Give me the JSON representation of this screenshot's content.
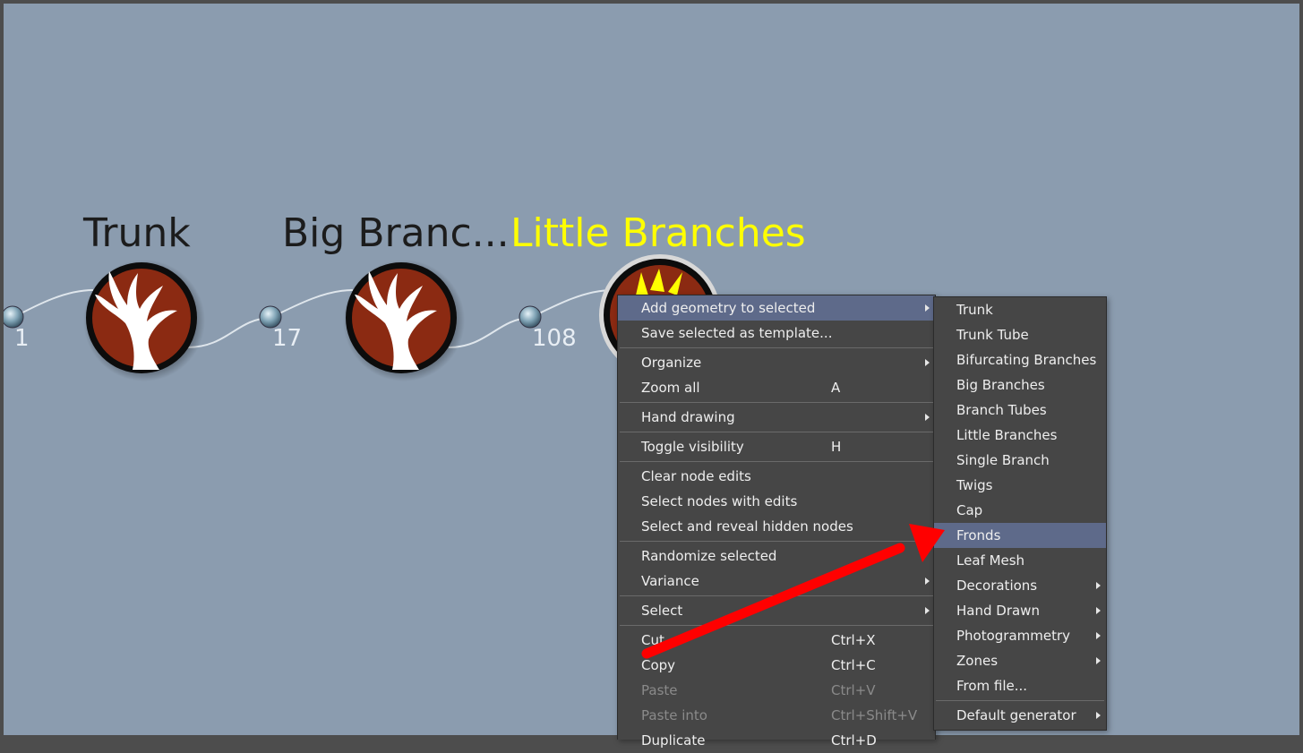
{
  "graph": {
    "nodes": [
      {
        "title": "Trunk",
        "port_count": "1",
        "title_color": "#1c1c1c"
      },
      {
        "title": "Big Branc...",
        "port_count": "17",
        "title_color": "#1c1c1c"
      },
      {
        "title": "Little Branches",
        "port_count": "108",
        "title_color": "#ffff00",
        "selected": true
      }
    ],
    "node_fill": "#8b2a12"
  },
  "context_menu": {
    "items": [
      {
        "label": "Add geometry to selected",
        "submenu": true,
        "highlighted": true
      },
      {
        "label": "Save selected as template..."
      },
      {
        "separator": true
      },
      {
        "label": "Organize",
        "submenu": true
      },
      {
        "label": "Zoom all",
        "shortcut": "A"
      },
      {
        "separator": true
      },
      {
        "label": "Hand drawing",
        "submenu": true
      },
      {
        "separator": true
      },
      {
        "label": "Toggle visibility",
        "shortcut": "H"
      },
      {
        "separator": true
      },
      {
        "label": "Clear node edits"
      },
      {
        "label": "Select nodes with edits"
      },
      {
        "label": "Select and reveal hidden nodes"
      },
      {
        "separator": true
      },
      {
        "label": "Randomize selected"
      },
      {
        "label": "Variance",
        "submenu": true
      },
      {
        "separator": true
      },
      {
        "label": "Select",
        "submenu": true
      },
      {
        "separator": true
      },
      {
        "label": "Cut",
        "shortcut": "Ctrl+X"
      },
      {
        "label": "Copy",
        "shortcut": "Ctrl+C"
      },
      {
        "label": "Paste",
        "shortcut": "Ctrl+V",
        "disabled": true
      },
      {
        "label": "Paste into",
        "shortcut": "Ctrl+Shift+V",
        "disabled": true
      },
      {
        "label": "Duplicate",
        "shortcut": "Ctrl+D"
      }
    ]
  },
  "geometry_submenu": {
    "items": [
      {
        "label": "Trunk"
      },
      {
        "label": "Trunk Tube"
      },
      {
        "label": "Bifurcating Branches"
      },
      {
        "label": "Big Branches"
      },
      {
        "label": "Branch Tubes"
      },
      {
        "label": "Little Branches"
      },
      {
        "label": "Single Branch"
      },
      {
        "label": "Twigs"
      },
      {
        "label": "Cap"
      },
      {
        "label": "Fronds",
        "highlighted": true
      },
      {
        "label": "Leaf Mesh"
      },
      {
        "label": "Decorations",
        "submenu": true
      },
      {
        "label": "Hand Drawn",
        "submenu": true
      },
      {
        "label": "Photogrammetry",
        "submenu": true
      },
      {
        "label": "Zones",
        "submenu": true
      },
      {
        "label": "From file..."
      },
      {
        "separator": true
      },
      {
        "label": "Default generator",
        "submenu": true
      }
    ]
  },
  "colors": {
    "canvas": "#8b9caf",
    "menu_bg": "#464646",
    "menu_highlight": "#5e6a8a",
    "annotation_arrow": "#ff0000"
  }
}
